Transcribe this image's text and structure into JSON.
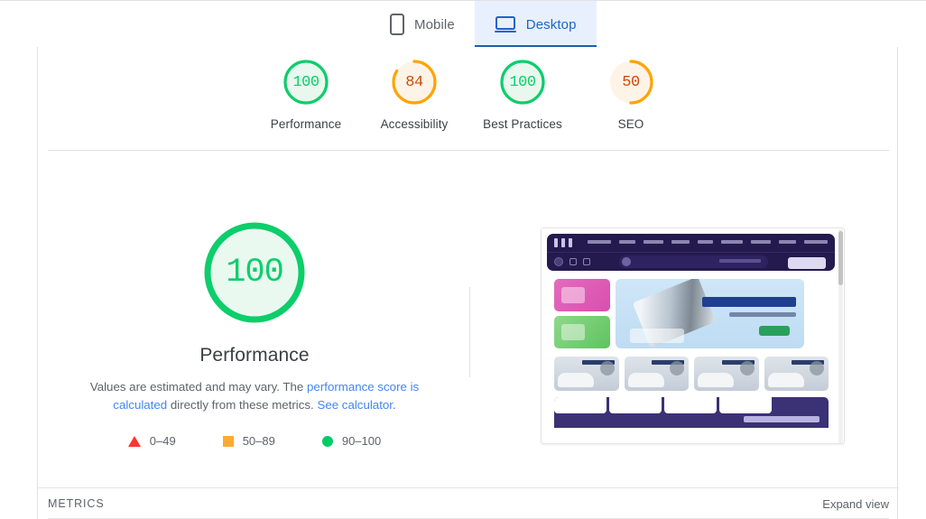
{
  "tabs": [
    {
      "label": "Mobile",
      "icon": "mobile-icon",
      "active": false
    },
    {
      "label": "Desktop",
      "icon": "desktop-icon",
      "active": true
    }
  ],
  "scores": [
    {
      "label": "Performance",
      "value": "100",
      "color": "#0cce6b"
    },
    {
      "label": "Accessibility",
      "value": "84",
      "color": "#ffa400"
    },
    {
      "label": "Best Practices",
      "value": "100",
      "color": "#0cce6b"
    },
    {
      "label": "SEO",
      "value": "50",
      "color": "#ffa400"
    }
  ],
  "performance": {
    "value": "100",
    "title": "Performance",
    "desc_part1": "Values are estimated and may vary. The",
    "link_calculated": "performance score is calculated",
    "desc_part2": "directly from these metrics.",
    "link_calculator": "See calculator",
    "desc_part3": "."
  },
  "legend": [
    {
      "label": "0–49",
      "shape": "triangle-icon",
      "color": "#ff3333"
    },
    {
      "label": "50–89",
      "shape": "square-icon",
      "color": "#ffaa33"
    },
    {
      "label": "90–100",
      "shape": "circle-icon",
      "color": "#00cc66"
    }
  ],
  "footer": {
    "metrics_label": "METRICS",
    "expand_view_label": "Expand view"
  },
  "colors": {
    "pass": "#0cce6b",
    "average": "#ffa400",
    "fail": "#ff3333",
    "link": "#4285f4",
    "tab_active_bg": "#e8f0fe",
    "tab_active_text": "#1a66c9"
  }
}
